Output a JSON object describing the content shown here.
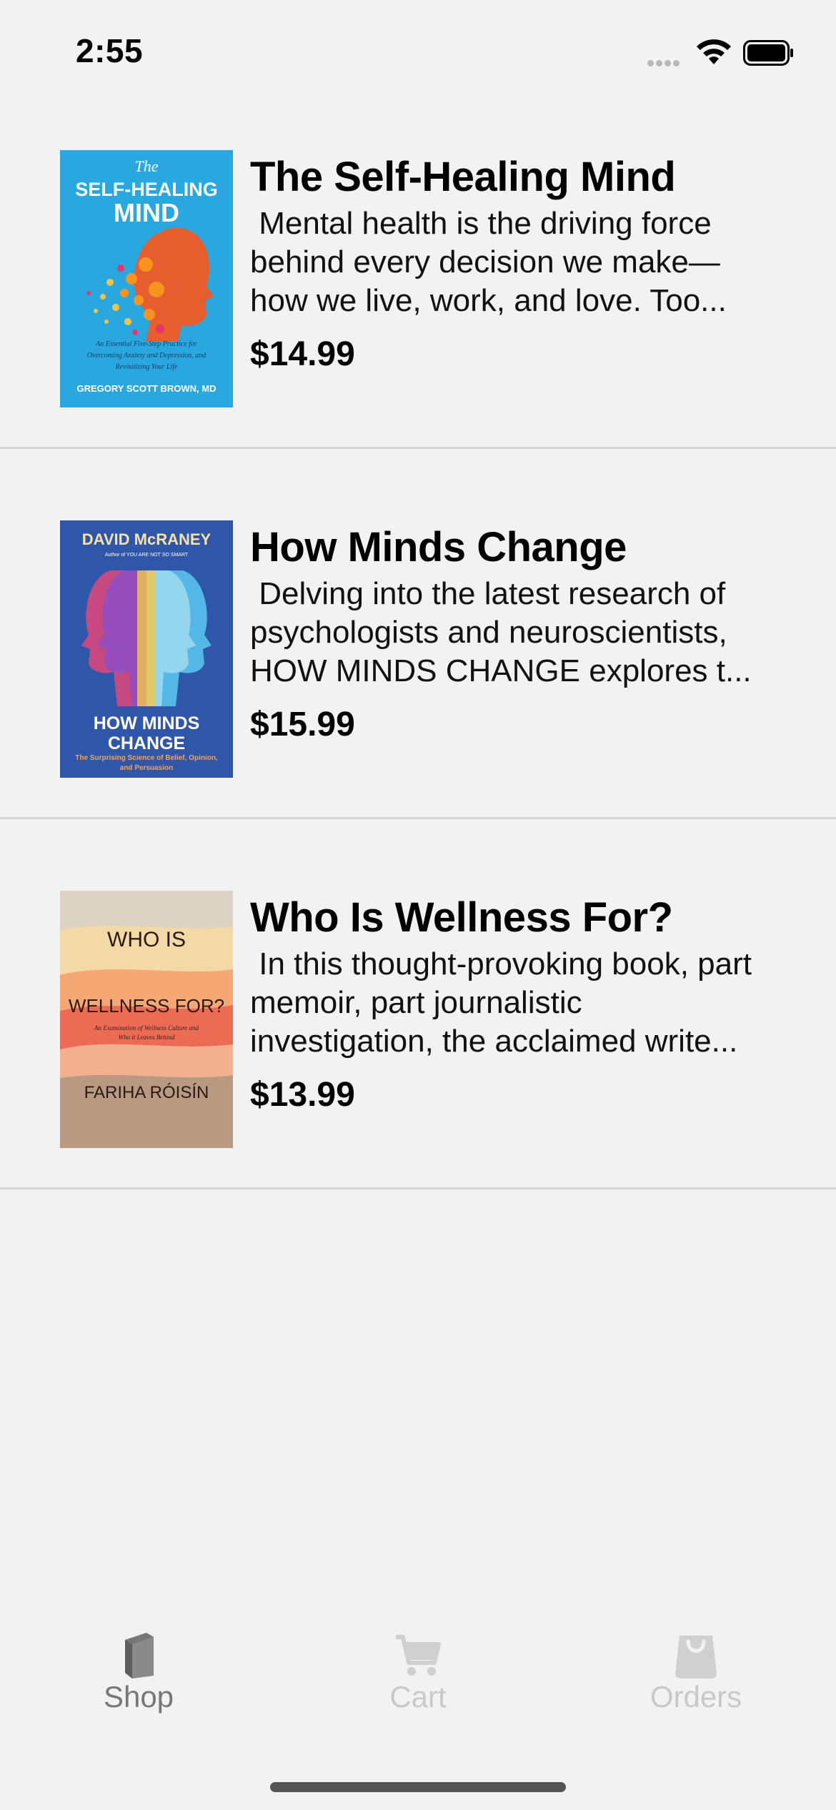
{
  "status_bar": {
    "time": "2:55"
  },
  "books": [
    {
      "title": "The Self-Healing Mind",
      "description": " Mental health is the driving force behind every decision we make—how we live, work, and love. Too...",
      "price": "$14.99",
      "cover": {
        "background": "#29a8e0",
        "lines": [
          "The",
          "SELF-HEALING",
          "MIND"
        ],
        "subtitle": "An Essential Five-Step Practice for Overcoming Anxiety and Depression, and Revitalizing Your Life",
        "author": "GREGORY SCOTT BROWN, MD"
      }
    },
    {
      "title": "How Minds Change",
      "description": " Delving into the latest research of psychologists and neuroscientists, HOW MINDS CHANGE explores t...",
      "price": "$15.99",
      "cover": {
        "background": "#2f56a8",
        "author": "DAVID McRANEY",
        "tagline": "Author of YOU ARE NOT SO SMART",
        "lines": [
          "HOW MINDS",
          "CHANGE"
        ],
        "subtitle": "The Surprising Science of Belief, Opinion, and Persuasion"
      }
    },
    {
      "title": "Who Is Wellness For?",
      "description": " In this thought-provoking book, part memoir, part journalistic investigation, the acclaimed write...",
      "price": "$13.99",
      "cover": {
        "background": "#e9c7a4",
        "lines": [
          "WHO IS",
          "WELLNESS FOR?"
        ],
        "subtitle": "An Examination of Wellness Culture and Who it Leaves Behind",
        "author": "FARIHA RÓISÍN"
      }
    }
  ],
  "tabs": [
    {
      "label": "Shop",
      "icon": "book-icon",
      "active": true
    },
    {
      "label": "Cart",
      "icon": "cart-icon",
      "active": false
    },
    {
      "label": "Orders",
      "icon": "bag-icon",
      "active": false
    }
  ],
  "colors": {
    "background": "#f2f2f2",
    "divider": "#d5d5d5",
    "tab_active": "#777777",
    "tab_inactive": "#c9c9c9"
  }
}
